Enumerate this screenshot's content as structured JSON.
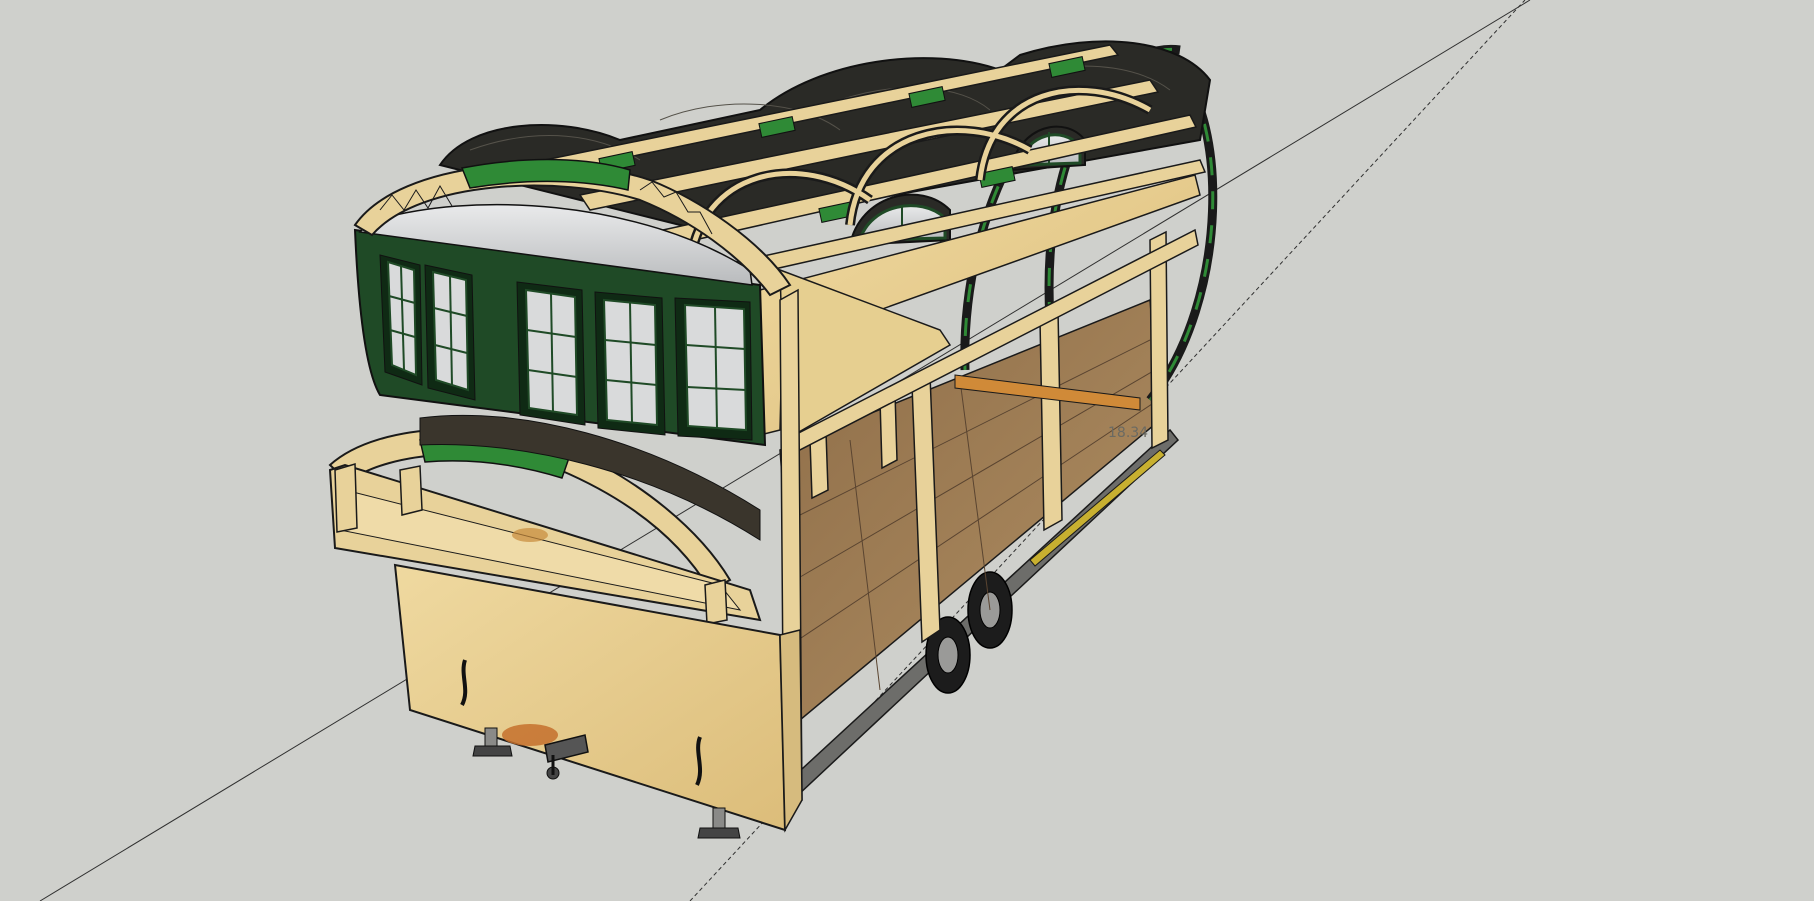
{
  "viewport": {
    "background": "#cfd0cc",
    "measurement_label": "18.34"
  },
  "colors": {
    "wood": "#e8d29a",
    "wood_dark": "#c9ad6b",
    "plywood": "#e3c78a",
    "floor": "#a0805a",
    "green_panel": "#1f4a26",
    "green_accent": "#2f8a36",
    "glass": "#c9cbcd",
    "outline": "#1a1a1a",
    "axis": "#202020"
  }
}
